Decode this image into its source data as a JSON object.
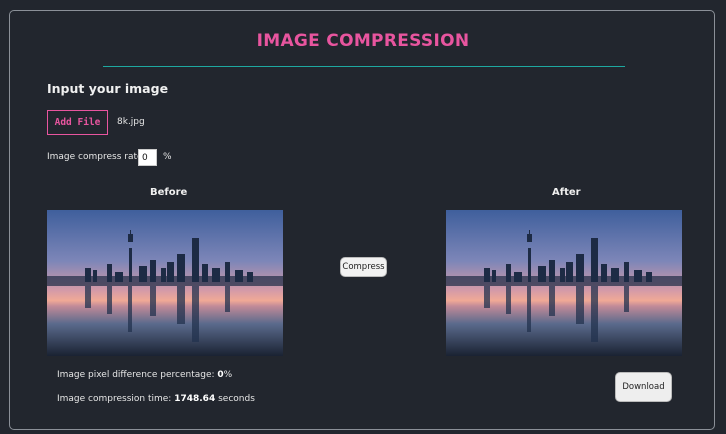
{
  "header": {
    "title": "IMAGE COMPRESSION"
  },
  "input": {
    "heading": "Input your image",
    "add_file_label": "Add File",
    "file_name": "8k.jpg",
    "rate_label": "Image compress rate:",
    "rate_value": "0",
    "rate_unit": "%"
  },
  "preview": {
    "before_label": "Before",
    "after_label": "After",
    "compress_label": "Compress",
    "download_label": "Download"
  },
  "stats": {
    "pixel_diff_label": "Image pixel difference percentage:",
    "pixel_diff_value": "0",
    "pixel_diff_unit": "%",
    "time_label": "Image compression time:",
    "time_value": "1748.64",
    "time_unit": "seconds"
  },
  "colors": {
    "accent": "#e8559f",
    "divider": "#1ea8a0",
    "background": "#22262e"
  }
}
